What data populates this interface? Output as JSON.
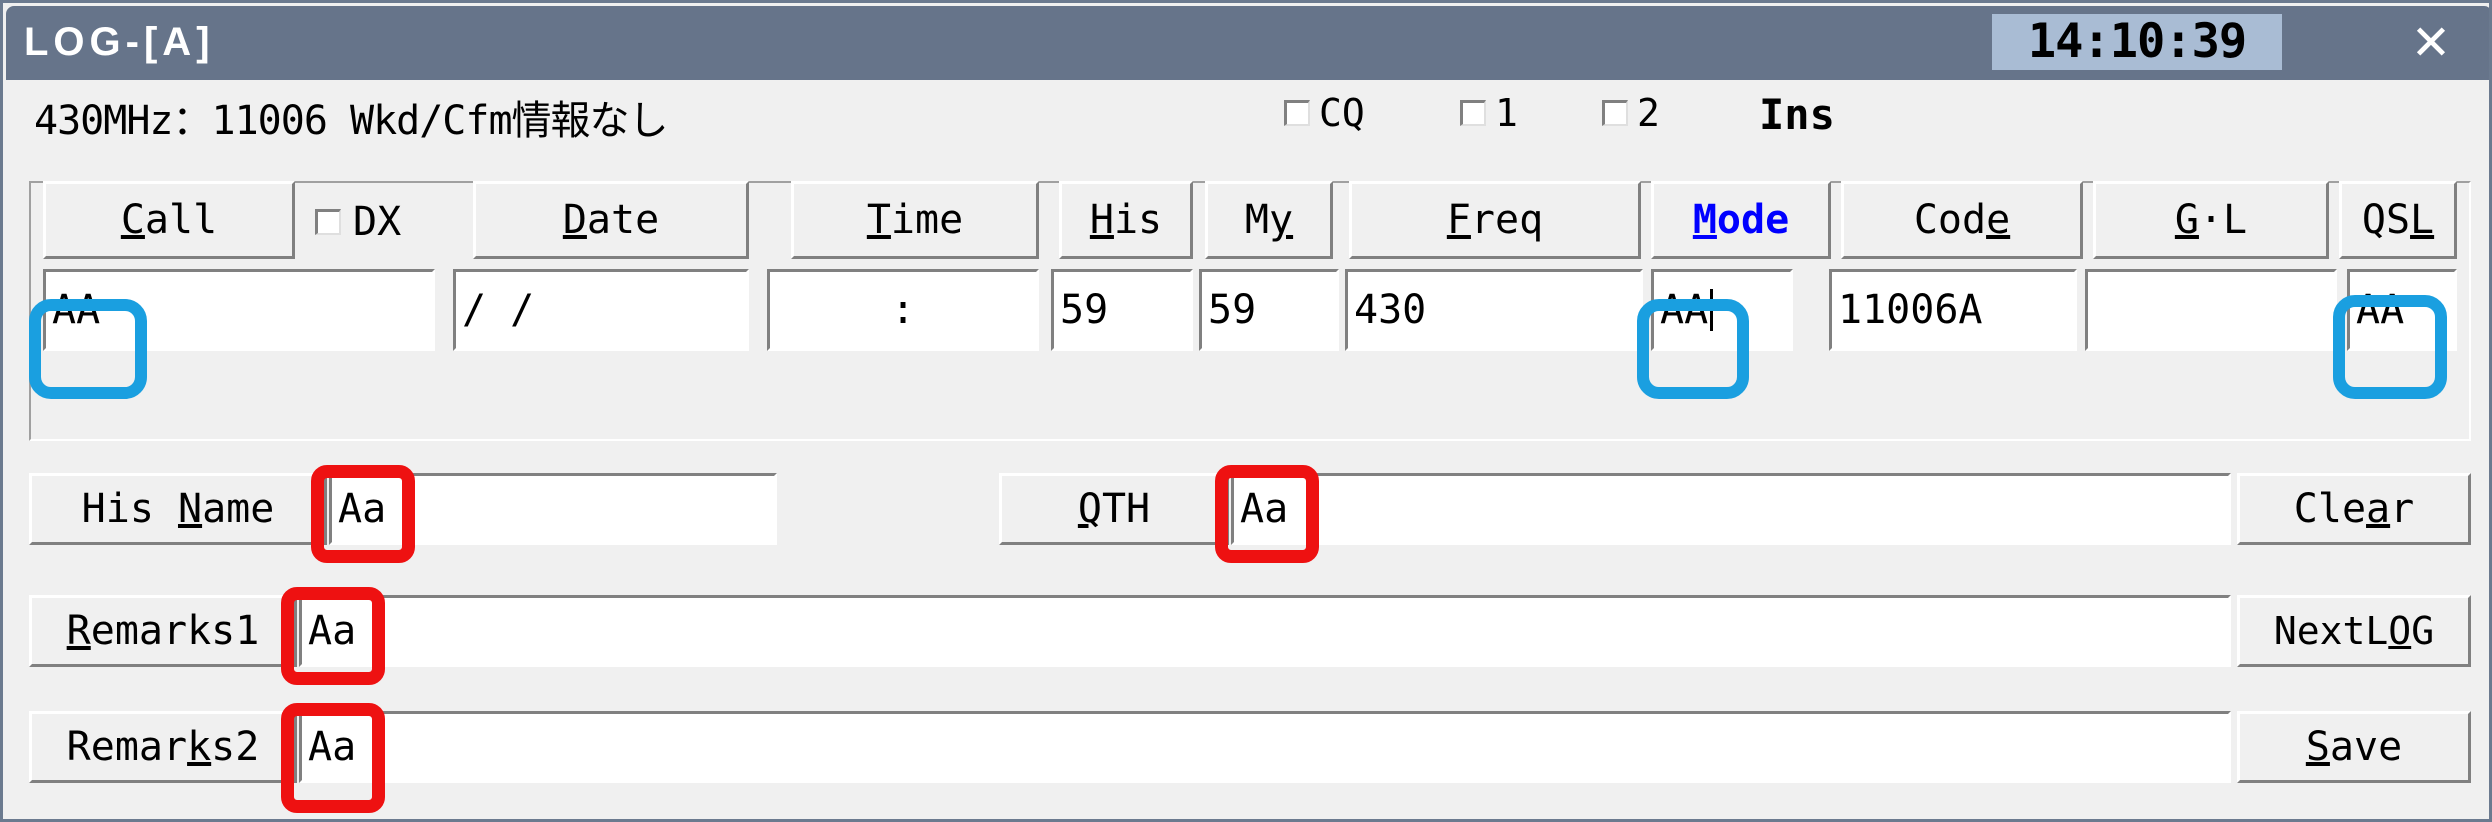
{
  "window": {
    "title": "L O G - [ A ]",
    "title_display": "LOG-[A]",
    "clock": "14:10:39",
    "close_label": "✕",
    "titlebar_color": "#66748a",
    "clock_bg": "#a9bcd4"
  },
  "infobar": {
    "band_info": "430MHz：11006 Wkd/Cfm情報なし",
    "checkboxes": [
      {
        "label": "CQ",
        "checked": false
      },
      {
        "label": "1",
        "checked": false
      },
      {
        "label": "2",
        "checked": false
      }
    ],
    "mode_indicator": "Ins"
  },
  "fields": {
    "headers": [
      {
        "name": "call",
        "label": "Call",
        "accel": "C",
        "color": "#000000"
      },
      {
        "name": "date",
        "label": "Date",
        "accel": "D",
        "color": "#000000"
      },
      {
        "name": "time",
        "label": "Time",
        "accel": "T",
        "color": "#000000"
      },
      {
        "name": "his",
        "label": "His",
        "accel": "H",
        "color": "#000000"
      },
      {
        "name": "my",
        "label": "My",
        "accel": "y",
        "color": "#000000"
      },
      {
        "name": "freq",
        "label": "Freq",
        "accel": "F",
        "color": "#000000"
      },
      {
        "name": "mode",
        "label": "Mode",
        "accel": "M",
        "color": "#0000ff"
      },
      {
        "name": "code",
        "label": "Code",
        "accel": "e",
        "color": "#000000"
      },
      {
        "name": "gl",
        "label": "G·L",
        "accel": "G",
        "color": "#000000"
      },
      {
        "name": "qsl",
        "label": "QSL",
        "accel": "L",
        "color": "#000000"
      }
    ],
    "dx_checkbox": {
      "label": "DX",
      "accel": "X",
      "checked": false
    },
    "values": {
      "call": "AA",
      "date": "  /    /",
      "time": ":",
      "his": "59",
      "my": "59",
      "freq": "430",
      "mode": "AA",
      "code": "11006A",
      "gl": "",
      "qsl": "AA"
    }
  },
  "lower": {
    "his_name": {
      "label": "His Name",
      "accel": "N",
      "value": "Aa"
    },
    "qth": {
      "label": "QTH",
      "accel": "Q",
      "value": "Aa"
    },
    "remarks1": {
      "label": "Remarks1",
      "accel": "R",
      "value": "Aa"
    },
    "remarks2": {
      "label": "Remarks2",
      "accel": "k",
      "value": "Aa"
    }
  },
  "actions": [
    {
      "name": "clear",
      "label": "Clear",
      "accel": "a"
    },
    {
      "name": "nextlog",
      "label": "NextLOG",
      "accel": "O"
    },
    {
      "name": "save",
      "label": "Save",
      "accel": "S"
    }
  ],
  "annotations": {
    "cyan_color": "#1a9fe0",
    "red_color": "#ee1111",
    "cyan_targets": [
      "call-input",
      "mode-input",
      "qsl-input"
    ],
    "red_targets": [
      "his-name-input",
      "qth-input",
      "remarks1-input",
      "remarks2-input"
    ]
  }
}
